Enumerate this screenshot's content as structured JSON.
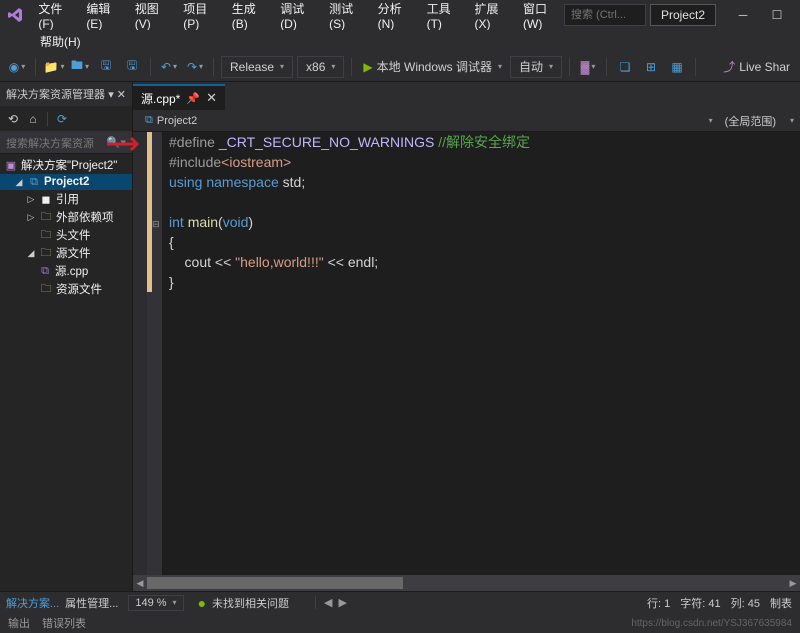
{
  "menu": {
    "row1": [
      "文件(F)",
      "编辑(E)",
      "视图(V)",
      "项目(P)",
      "生成(B)",
      "调试(D)",
      "测试(S)",
      "分析(N)",
      "工具(T)",
      "扩展(X)",
      "窗口(W)"
    ],
    "row2": [
      "帮助(H)"
    ]
  },
  "title_right": {
    "search_placeholder": "搜索 (Ctrl...",
    "project_name": "Project2"
  },
  "toolbar": {
    "config": "Release",
    "platform": "x86",
    "debugger": "本地 Windows 调试器",
    "auto": "自动",
    "liveshare": "Live Shar"
  },
  "solution_explorer": {
    "title": "解决方案资源管理器",
    "search_placeholder": "搜索解决方案资源",
    "tree": {
      "solution": "解决方案\"Project2\"",
      "project": "Project2",
      "refs": "引用",
      "external": "外部依赖项",
      "headers": "头文件",
      "sources": "源文件",
      "source_cpp": "源.cpp",
      "resources": "资源文件"
    }
  },
  "editor": {
    "tab_name": "源.cpp*",
    "breadcrumb_project": "Project2",
    "breadcrumb_scope": "(全局范围)",
    "code": {
      "l1_define": "#define",
      "l1_macro": "_CRT_SECURE_NO_WARNINGS",
      "l1_comment": "//解除安全绑定",
      "l2_include": "#include",
      "l2_header": "<iostream>",
      "l3_using": "using",
      "l3_namespace": "namespace",
      "l3_std": "std;",
      "l5_int": "int",
      "l5_main": "main",
      "l5_void": "void",
      "l7_cout": "    cout << ",
      "l7_str": "\"hello,world!!!\"",
      "l7_endl": " << endl;"
    }
  },
  "status": {
    "sidebar_tab1": "解决方案...",
    "sidebar_tab2": "属性管理...",
    "zoom": "149 %",
    "no_issues": "未找到相关问题",
    "line_label": "行:",
    "line_val": "1",
    "char_label": "字符:",
    "char_val": "41",
    "col_label": "列:",
    "col_val": "45",
    "crlf": "制表",
    "bottom_output": "输出",
    "bottom_errors": "错误列表",
    "watermark": "https://blog.csdn.net/YSJ367635984"
  }
}
